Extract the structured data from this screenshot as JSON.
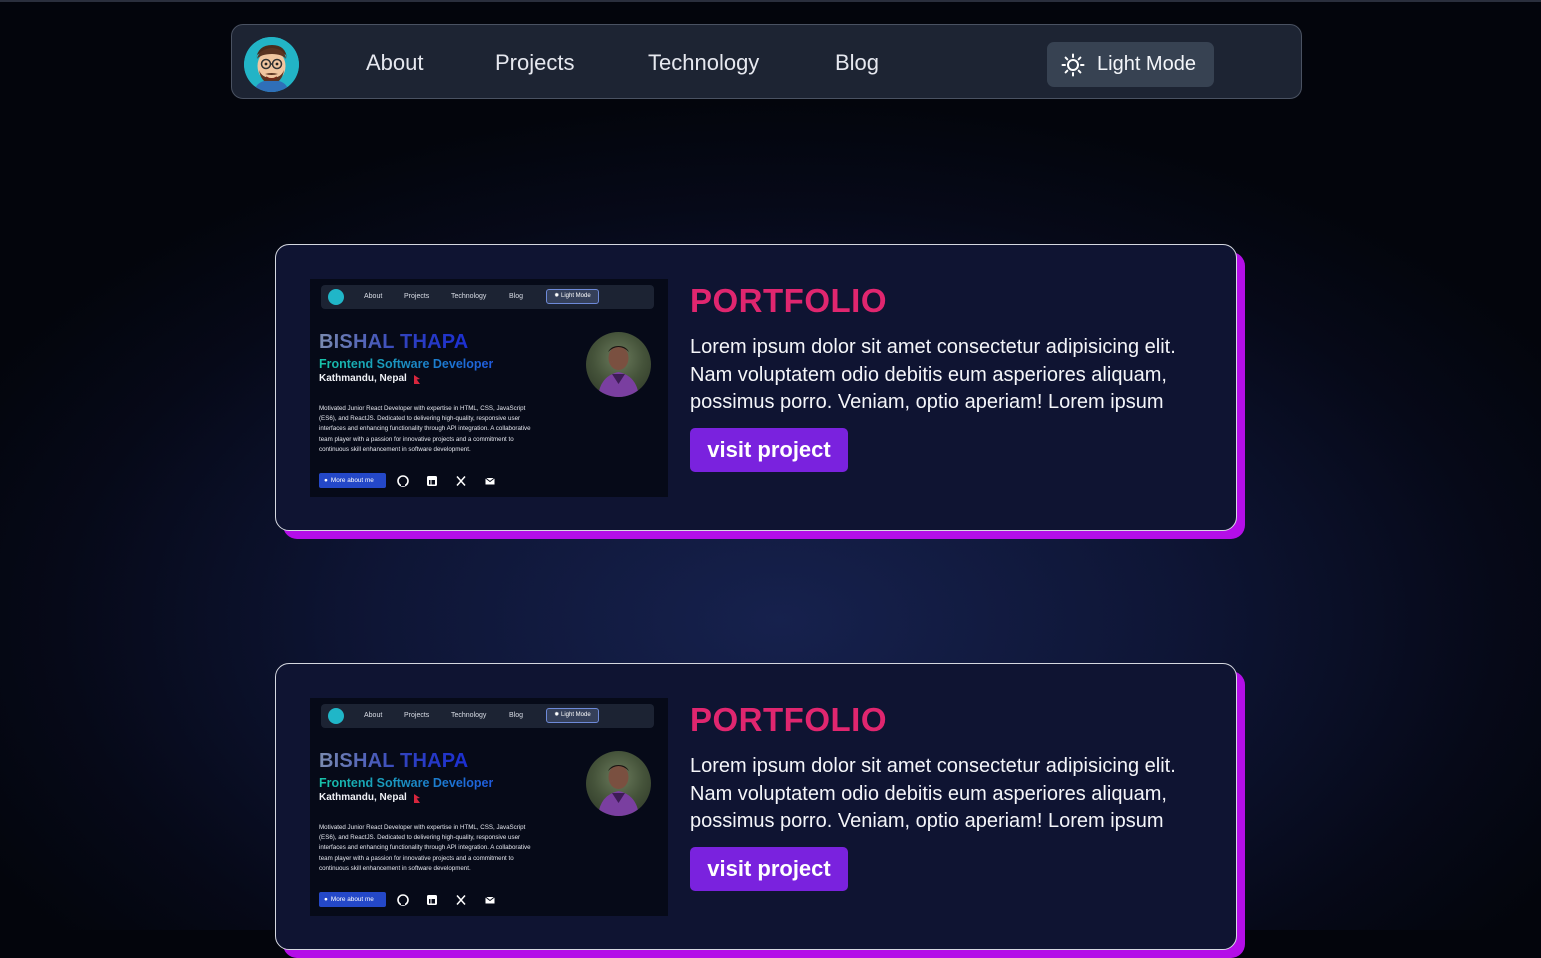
{
  "nav": {
    "links": [
      "About",
      "Projects",
      "Technology",
      "Blog"
    ],
    "theme_toggle_label": "Light Mode"
  },
  "colors": {
    "accent_purple": "#7a22de",
    "card_shadow": "#b40ee8",
    "title_pink": "#e0266f"
  },
  "projects": [
    {
      "title": "PORTFOLIO",
      "description": "Lorem ipsum dolor sit amet consectetur adipisicing elit. Nam voluptatem odio debitis eum asperiores aliquam, possimus porro. Veniam, optio aperiam! Lorem ipsum",
      "button_label": "visit project",
      "preview": {
        "nav_links": [
          "About",
          "Projects",
          "Technology",
          "Blog"
        ],
        "theme_label": "Light Mode",
        "name": "BISHAL THAPA",
        "role": "Frontend Software Developer",
        "location": "Kathmandu, Nepal",
        "bio": "Motivated Junior React Developer with expertise in HTML, CSS, JavaScript (ES6), and ReactJS. Dedicated to delivering high-quality, responsive user interfaces and enhancing functionality through API integration. A collaborative team player with a passion for innovative projects and a commitment to continuous skill enhancement in software development.",
        "button_label": "More about me",
        "social_icons": [
          "github-icon",
          "linkedin-icon",
          "x-icon",
          "mail-icon"
        ]
      }
    },
    {
      "title": "PORTFOLIO",
      "description": "Lorem ipsum dolor sit amet consectetur adipisicing elit. Nam voluptatem odio debitis eum asperiores aliquam, possimus porro. Veniam, optio aperiam! Lorem ipsum",
      "button_label": "visit project",
      "preview": {
        "nav_links": [
          "About",
          "Projects",
          "Technology",
          "Blog"
        ],
        "theme_label": "Light Mode",
        "name": "BISHAL THAPA",
        "role": "Frontend Software Developer",
        "location": "Kathmandu, Nepal",
        "bio": "Motivated Junior React Developer with expertise in HTML, CSS, JavaScript (ES6), and ReactJS. Dedicated to delivering high-quality, responsive user interfaces and enhancing functionality through API integration. A collaborative team player with a passion for innovative projects and a commitment to continuous skill enhancement in software development.",
        "button_label": "More about me",
        "social_icons": [
          "github-icon",
          "linkedin-icon",
          "x-icon",
          "mail-icon"
        ]
      }
    }
  ]
}
